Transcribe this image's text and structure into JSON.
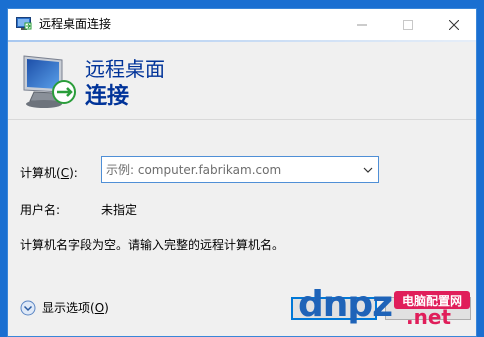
{
  "window": {
    "title": "远程桌面连接",
    "banner_line1": "远程桌面",
    "banner_line2": "连接"
  },
  "form": {
    "computer_label_prefix": "计算机(",
    "computer_label_accel": "C",
    "computer_label_suffix": "):",
    "computer_placeholder": "示例: computer.fabrikam.com",
    "computer_value": "",
    "username_label": "用户名:",
    "username_value": "未指定",
    "hint_text": "计算机名字段为空。请输入完整的远程计算机名。"
  },
  "footer": {
    "options_prefix": "显示选项(",
    "options_accel": "O",
    "options_suffix": ")",
    "connect_label": "",
    "help_label": ""
  },
  "watermark": {
    "brand_text": "dnpz",
    "badge_text": "电脑配置网",
    "tld_text": ".net"
  },
  "colors": {
    "desktop": "#1a6fd1",
    "banner_title": "#003399",
    "focus_border": "#4f8fd6"
  }
}
